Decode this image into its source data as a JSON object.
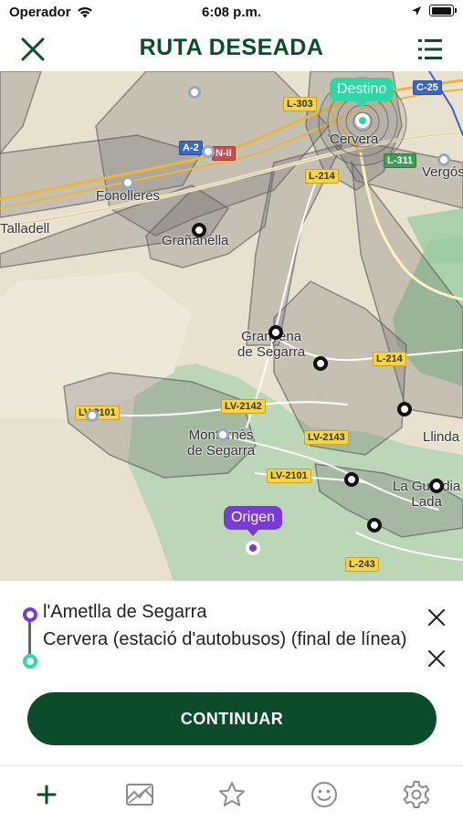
{
  "status_bar": {
    "carrier": "Operador",
    "time": "6:08 p.m."
  },
  "header": {
    "title": "RUTA DESEADA",
    "close_icon": "close-icon",
    "menu_icon": "list-icon"
  },
  "map": {
    "places": {
      "cervera": "Cervera",
      "fonolleres": "Fonolleres",
      "talladell": "Talladell",
      "granyanella": "Grañanella",
      "granyena": "Granyena\nde Segarra",
      "montornes": "Montornès\nde Segarra",
      "llinda": "Llinda",
      "la_guardia": "La Guàrdia\nLada",
      "vergos": "Vergós"
    },
    "roads": {
      "l303": "L-303",
      "c25": "C-25",
      "a2": "A-2",
      "n2": "N-II",
      "l311": "L-311",
      "l214_top": "L-214",
      "l214_mid": "L-214",
      "lv2101_left": "LV-2101",
      "lv2142": "LV-2142",
      "lv2143": "LV-2143",
      "lv2101_mid": "LV-2101",
      "l243": "L-243"
    },
    "pins": {
      "destino": "Destino",
      "origen": "Origen"
    },
    "colors": {
      "destino": "#2fd6a6",
      "origen": "#7a3ad6"
    }
  },
  "route": {
    "origin": "l'Ametlla de Segarra",
    "destination": "Cervera (estació d'autobusos) (final de línea)"
  },
  "continue_label": "CONTINUAR",
  "tabs": [
    {
      "icon": "plus-icon"
    },
    {
      "icon": "ticket-map-icon"
    },
    {
      "icon": "star-icon"
    },
    {
      "icon": "smile-icon"
    },
    {
      "icon": "gear-icon"
    }
  ],
  "brand_color": "#0b4d2b"
}
